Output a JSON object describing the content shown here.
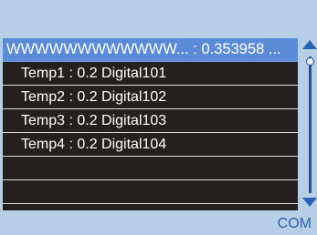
{
  "list": {
    "selected_item": "WWWWWWWWWWWW... : 0.353958 ...",
    "items": [
      "Temp1 : 0.2  Digital101",
      "Temp2 : 0.2  Digital102",
      "Temp3 : 0.2  Digital103",
      "Temp4 : 0.2  Digital104"
    ],
    "empty_rows": 2
  },
  "scrollbar": {
    "up_icon": "triangle-up-icon",
    "down_icon": "triangle-down-icon"
  },
  "status_bar": {
    "text": "COM"
  },
  "colors": {
    "panel": "#b6cee6",
    "list_background": "#24201f",
    "selection": "#5b8ad6",
    "accent": "#2a64b6"
  }
}
